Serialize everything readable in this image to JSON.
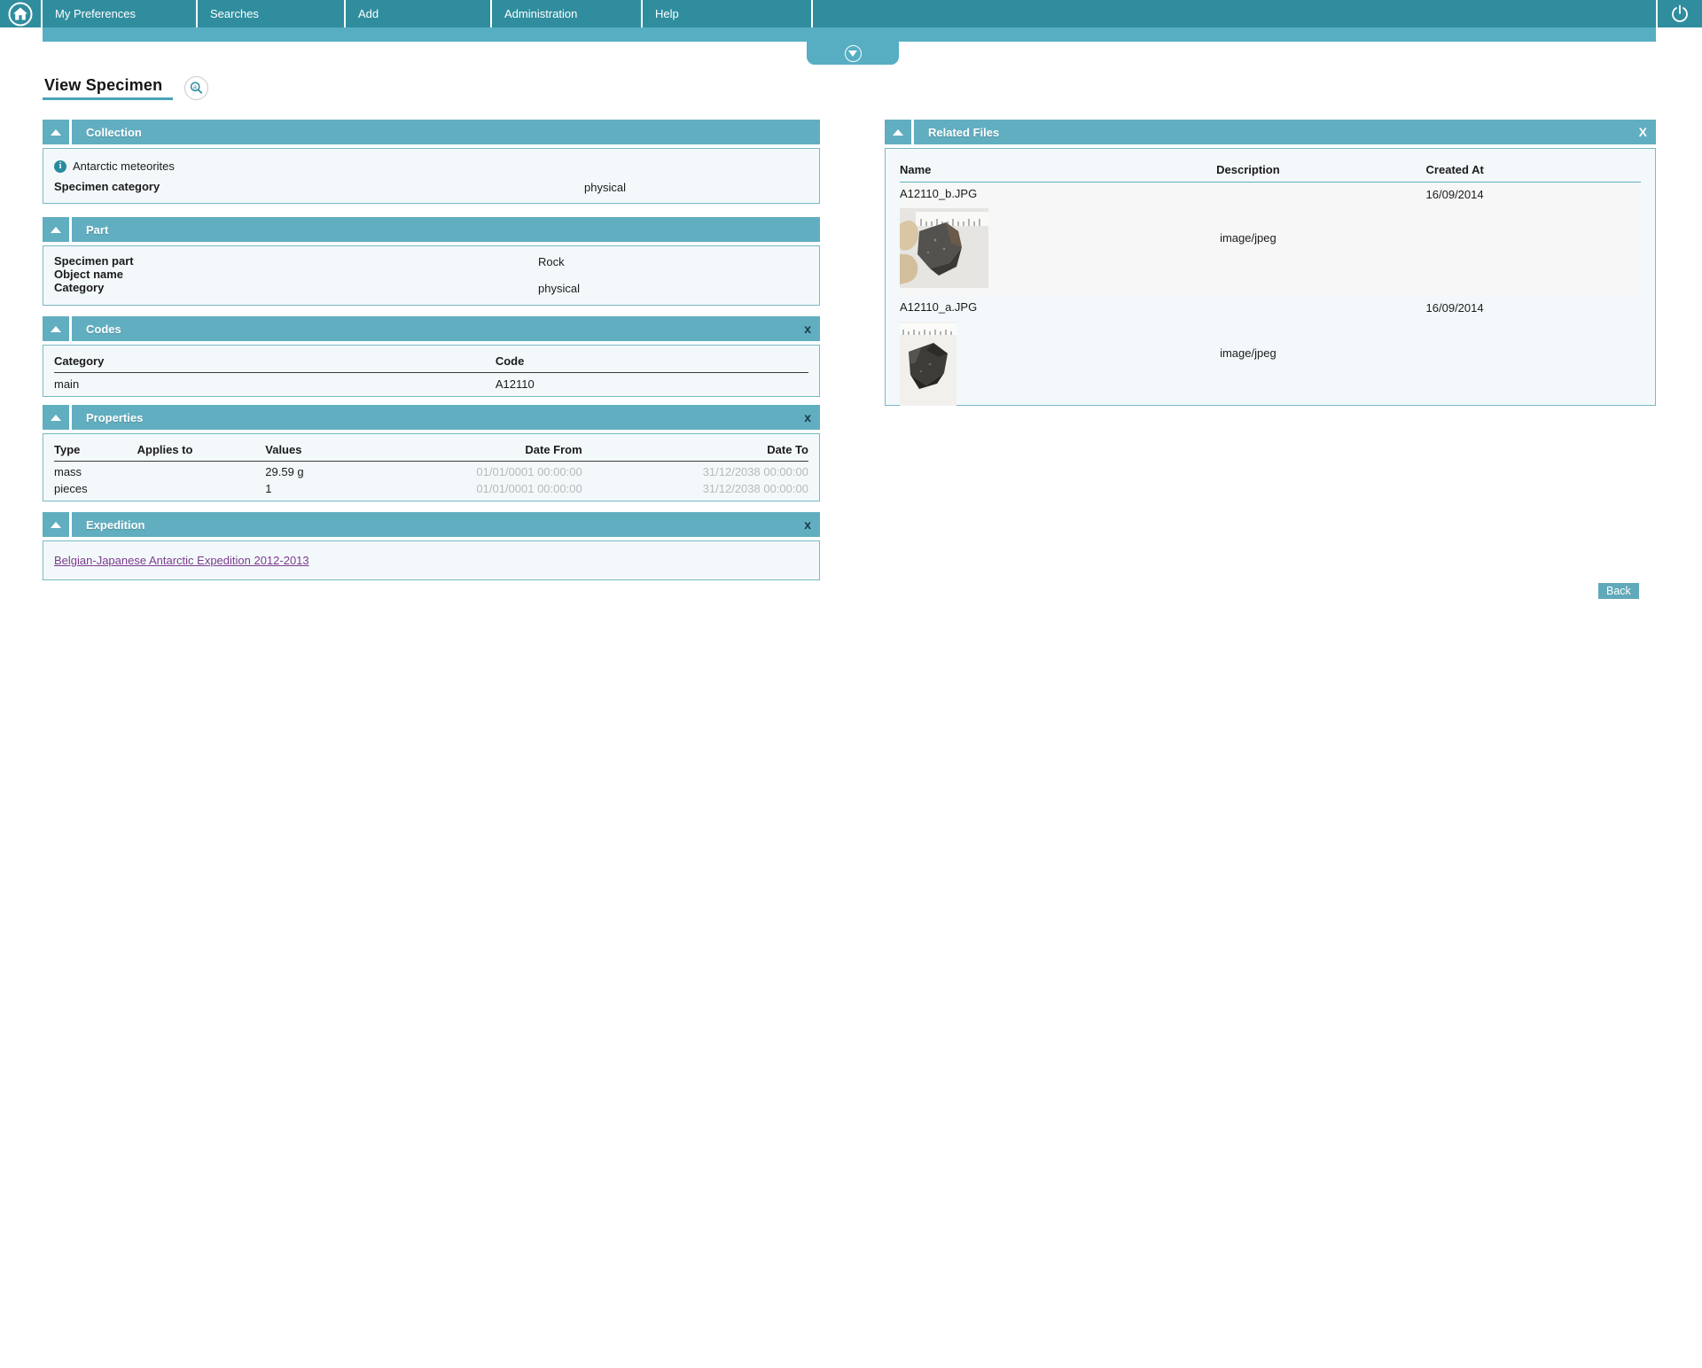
{
  "nav": {
    "items": [
      "My Preferences",
      "Searches",
      "Add",
      "Administration",
      "Help"
    ]
  },
  "icons": {
    "info": "i",
    "close_dark": "x",
    "close_light": "X"
  },
  "page": {
    "title": "View Specimen"
  },
  "collection": {
    "title": "Collection",
    "info_text": "Antarctic meteorites",
    "field_label": "Specimen category",
    "field_value": "physical"
  },
  "part": {
    "title": "Part",
    "rows": [
      {
        "label": "Specimen part",
        "value": "Rock"
      },
      {
        "label": "Object name",
        "value": ""
      },
      {
        "label": "Category",
        "value": "physical"
      }
    ]
  },
  "codes": {
    "title": "Codes",
    "columns": [
      "Category",
      "Code"
    ],
    "rows": [
      {
        "category": "main",
        "code": "A12110"
      }
    ]
  },
  "properties": {
    "title": "Properties",
    "columns": [
      "Type",
      "Applies to",
      "Values",
      "Date From",
      "Date To"
    ],
    "rows": [
      {
        "type": "mass",
        "applies_to": "",
        "values": "29.59 g",
        "date_from": "01/01/0001 00:00:00",
        "date_to": "31/12/2038 00:00:00"
      },
      {
        "type": "pieces",
        "applies_to": "",
        "values": "1",
        "date_from": "01/01/0001 00:00:00",
        "date_to": "31/12/2038 00:00:00"
      }
    ]
  },
  "expedition": {
    "title": "Expedition",
    "link_text": "Belgian-Japanese Antarctic Expedition 2012-2013"
  },
  "related_files": {
    "title": "Related Files",
    "columns": [
      "Name",
      "Description",
      "Created At"
    ],
    "rows": [
      {
        "name": "A12110_b.JPG",
        "description": "image/jpeg",
        "created_at": "16/09/2014"
      },
      {
        "name": "A12110_a.JPG",
        "description": "image/jpeg",
        "created_at": "16/09/2014"
      }
    ]
  },
  "buttons": {
    "back": "Back"
  },
  "colors": {
    "navbar": "#2f8d9e",
    "accent_light": "#57aec3",
    "panel_header": "#61aec0",
    "panel_border": "#79b8c6",
    "panel_bg": "#f3f9fb",
    "link": "#7d3a8d",
    "date_muted": "#b9b9b9",
    "back_button": "#60a9ba"
  }
}
